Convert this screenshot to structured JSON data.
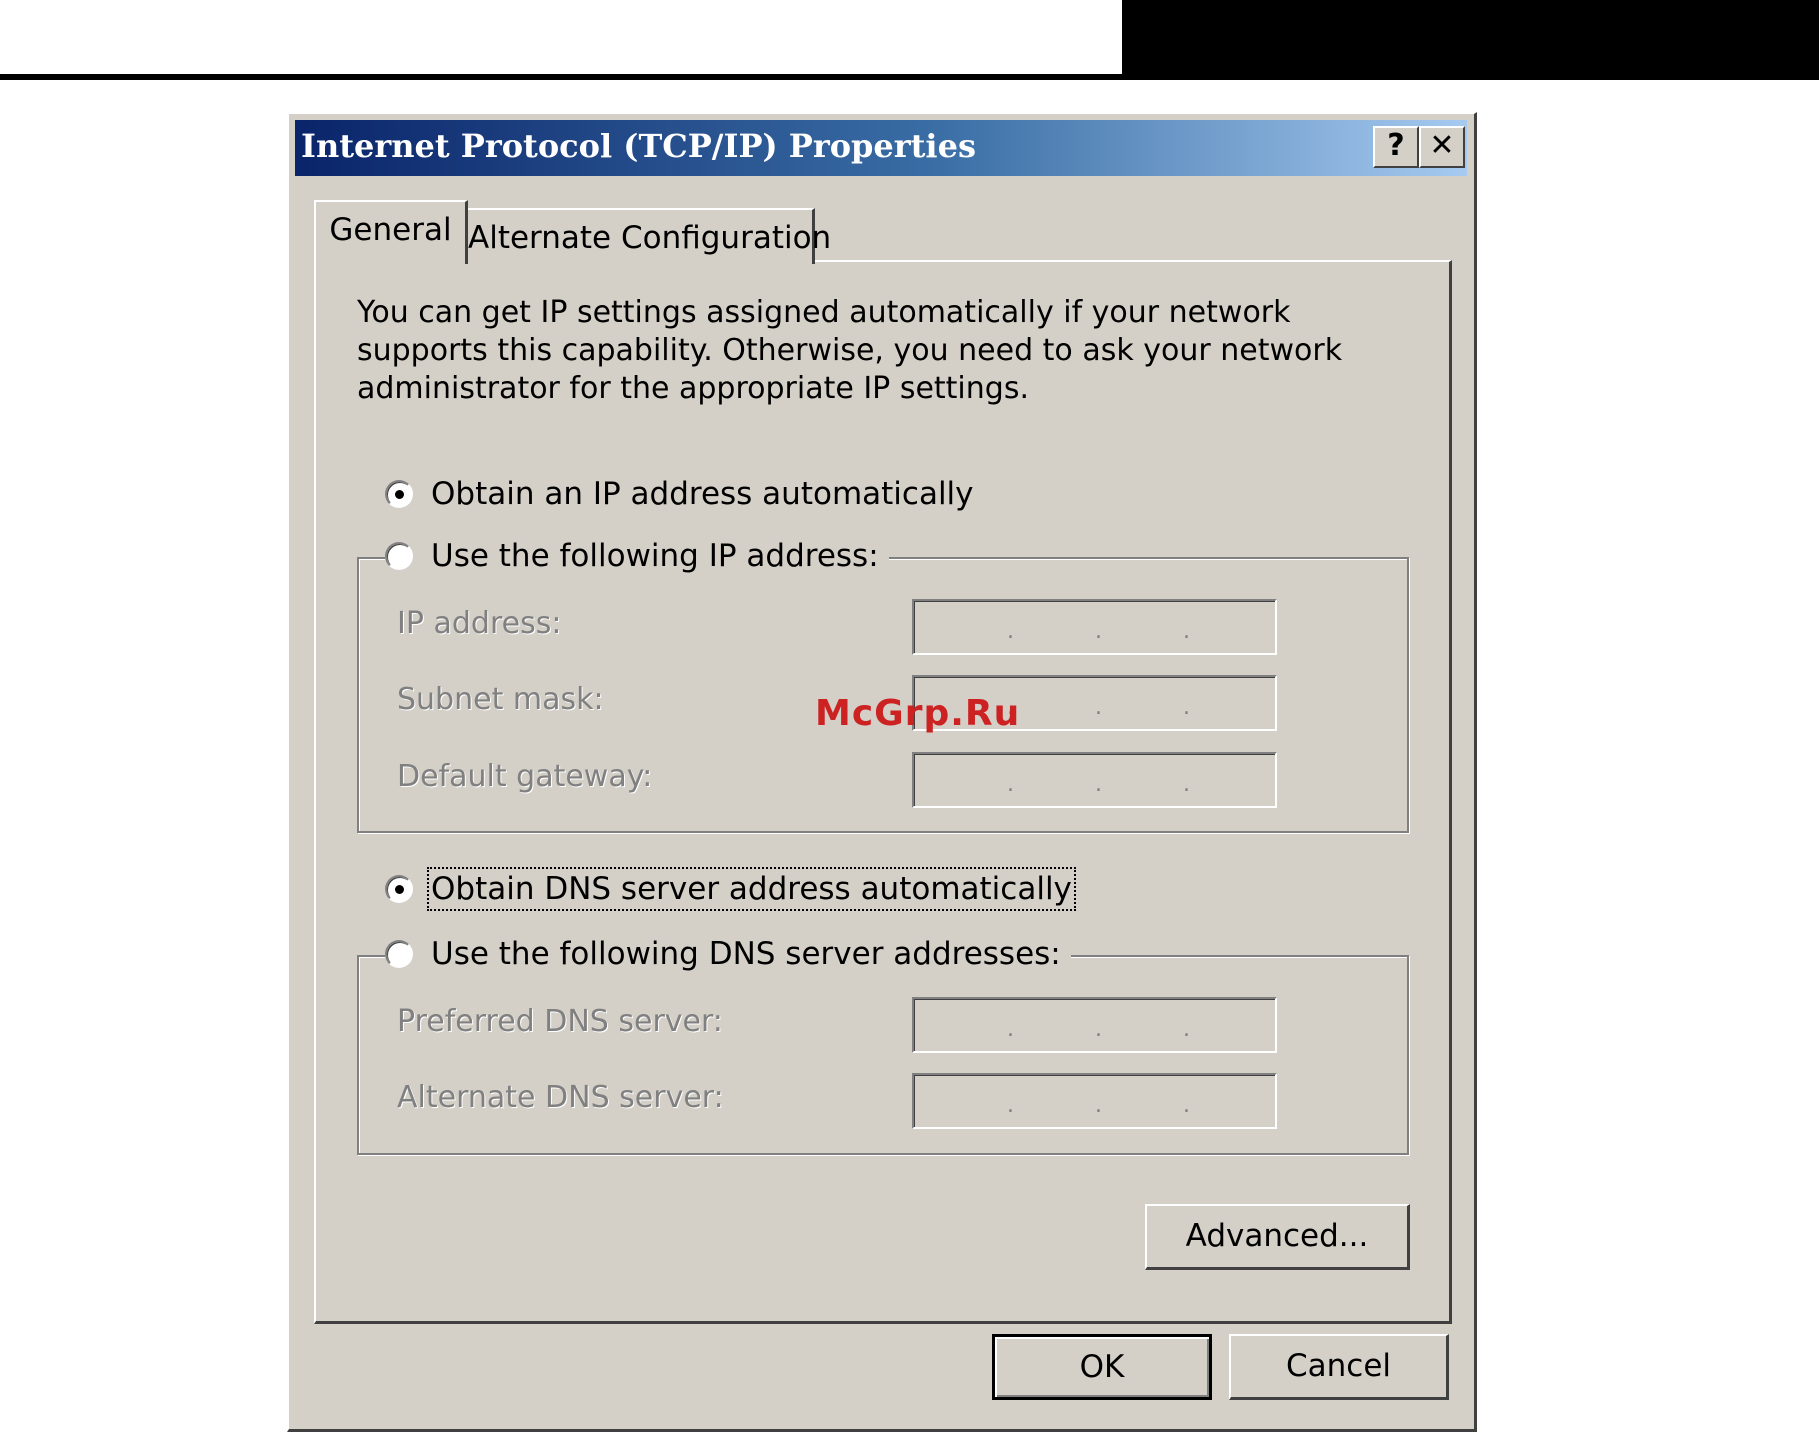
{
  "dialog": {
    "title": "Internet Protocol (TCP/IP) Properties",
    "help_button": "?",
    "close_button": "✕"
  },
  "tabs": [
    {
      "label": "General",
      "selected": true
    },
    {
      "label": "Alternate Configuration",
      "selected": false
    }
  ],
  "general": {
    "description": "You can get IP settings assigned automatically if your network supports this capability. Otherwise, you need to ask your network administrator for the appropriate IP settings.",
    "ip_auto_label": "Obtain an IP address automatically",
    "ip_manual_label": "Use the following IP address:",
    "ip_mode": "automatic",
    "ip_address_label": "IP address:",
    "subnet_mask_label": "Subnet mask:",
    "default_gateway_label": "Default gateway:",
    "dns_auto_label": "Obtain DNS server address automatically",
    "dns_manual_label": "Use the following DNS server addresses:",
    "dns_mode": "automatic",
    "preferred_dns_label": "Preferred DNS server:",
    "alternate_dns_label": "Alternate DNS server:",
    "ip_separator": ".",
    "advanced_button": "Advanced..."
  },
  "footer": {
    "ok_button": "OK",
    "cancel_button": "Cancel"
  },
  "watermark": "McGrp.Ru"
}
